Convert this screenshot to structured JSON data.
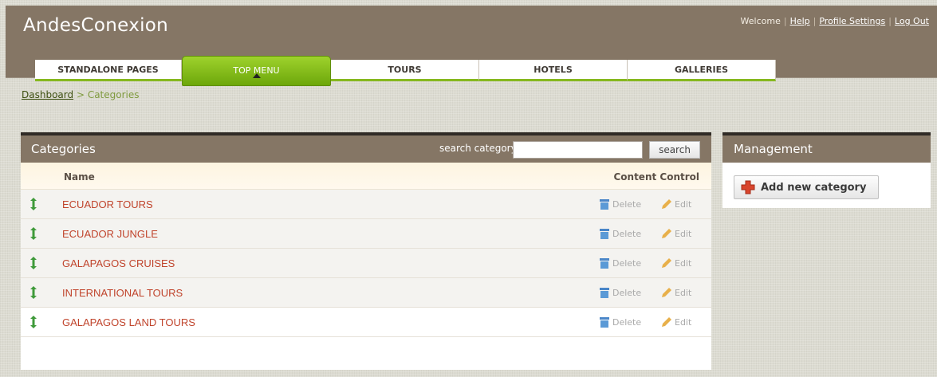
{
  "app": {
    "title": "AndesConexion"
  },
  "toplinks": {
    "welcome": "Welcome",
    "help": "Help",
    "profile": "Profile Settings",
    "logout": "Log Out"
  },
  "tabs": [
    {
      "label": "STANDALONE PAGES",
      "active": false
    },
    {
      "label": "TOP MENU",
      "active": true
    },
    {
      "label": "TOURS",
      "active": false
    },
    {
      "label": "HOTELS",
      "active": false
    },
    {
      "label": "GALLERIES",
      "active": false
    }
  ],
  "breadcrumb": {
    "home": "Dashboard",
    "separator": ">",
    "current": "Categories"
  },
  "categories": {
    "title": "Categories",
    "search_label": "search category",
    "search_value": "",
    "search_button": "search",
    "col_name": "Name",
    "col_control": "Content Control",
    "delete_label": "Delete",
    "edit_label": "Edit",
    "rows": [
      {
        "name": "ECUADOR TOURS"
      },
      {
        "name": "ECUADOR JUNGLE"
      },
      {
        "name": "GALAPAGOS CRUISES"
      },
      {
        "name": "INTERNATIONAL TOURS"
      },
      {
        "name": "GALAPAGOS LAND TOURS"
      }
    ]
  },
  "management": {
    "title": "Management",
    "add_button": "Add new category"
  },
  "icons": {
    "move": "move-updown-icon",
    "delete": "trash-icon",
    "edit": "pencil-icon",
    "add": "add-cross-icon"
  },
  "colors": {
    "header": "#857665",
    "accent_green": "#86b820",
    "link_red": "#c0442c"
  }
}
